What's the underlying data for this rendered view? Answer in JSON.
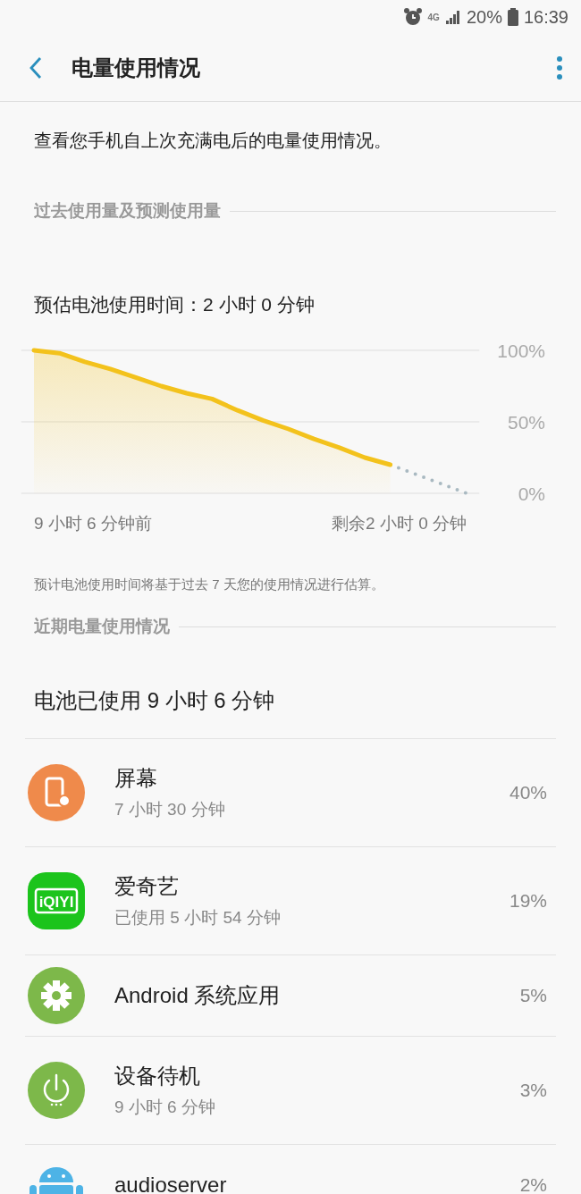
{
  "status_bar": {
    "network": "4G",
    "battery": "20%",
    "time": "16:39"
  },
  "header": {
    "title": "电量使用情况"
  },
  "description": "查看您手机自上次充满电后的电量使用情况。",
  "history_section": {
    "heading": "过去使用量及预测使用量",
    "estimate": "预估电池使用时间：2 小时 0 分钟",
    "chart_data": {
      "type": "area",
      "categories": [
        null,
        null,
        null,
        null,
        null,
        null,
        null,
        null,
        null,
        null,
        null,
        null,
        null,
        null,
        null,
        null,
        null,
        null
      ],
      "ylim": [
        0,
        100
      ],
      "yticks": [
        {
          "value": 0,
          "label": "0%"
        },
        {
          "value": 50,
          "label": "50%"
        },
        {
          "value": 100,
          "label": "100%"
        }
      ],
      "series": [
        {
          "color": "#f3c21c",
          "values": [
            100,
            98,
            92,
            87,
            81,
            75,
            70,
            66,
            58,
            51,
            45,
            38,
            32,
            25,
            20,
            null,
            null,
            null
          ]
        }
      ]
    },
    "prediction_line": {
      "dotted": true
    },
    "start_label": "9 小时 6 分钟前",
    "end_label": "剩余2 小时 0 分钟",
    "note": "预计电池使用时间将基于过去 7 天您的使用情况进行估算。"
  },
  "recent_section": {
    "heading": "近期电量使用情况",
    "total": "电池已使用 9 小时 6 分钟",
    "items": [
      {
        "kind": "screen",
        "name": "屏幕",
        "detail": "7 小时 30 分钟",
        "percent": "40%"
      },
      {
        "kind": "app",
        "icon_text": "iQIYI",
        "name": "爱奇艺",
        "detail": "已使用 5 小时 54 分钟",
        "percent": "19%"
      },
      {
        "kind": "system",
        "name": "Android 系统应用",
        "percent": "5%"
      },
      {
        "kind": "standby",
        "name": "设备待机",
        "detail": "9 小时 6 分钟",
        "percent": "3%"
      },
      {
        "kind": "process",
        "name": "audioserver",
        "percent": "2%"
      }
    ]
  }
}
